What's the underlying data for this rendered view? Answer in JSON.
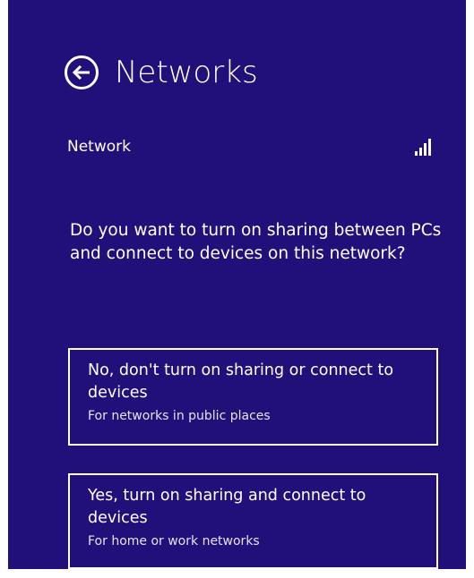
{
  "header": {
    "title": "Networks",
    "back_icon": "back-arrow-icon"
  },
  "network": {
    "name": "Network",
    "signal_icon": "signal-strength-icon"
  },
  "prompt": {
    "question": "Do you want to turn on sharing between PCs and connect to devices on this network?"
  },
  "options": {
    "no": {
      "label": "No, don't turn on sharing or connect to devices",
      "description": "For networks in public places"
    },
    "yes": {
      "label": "Yes, turn on sharing and connect to devices",
      "description": "For home or work networks"
    }
  },
  "colors": {
    "background": "#22107a",
    "text": "#ffffff"
  }
}
